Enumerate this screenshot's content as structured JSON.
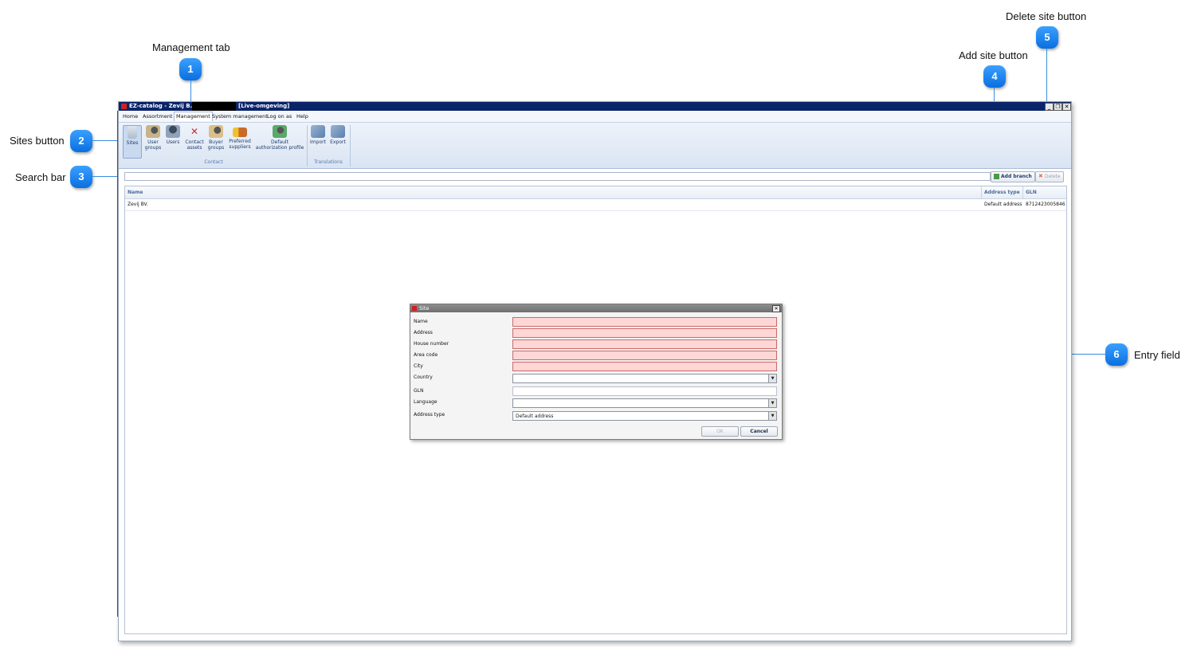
{
  "callouts": {
    "management_tab": {
      "label": "Management tab",
      "number": "1"
    },
    "sites_button": {
      "label": "Sites button",
      "number": "2"
    },
    "search_bar": {
      "label": "Search bar",
      "number": "3"
    },
    "add_site_button": {
      "label": "Add site button",
      "number": "4"
    },
    "delete_site_button": {
      "label": "Delete site button",
      "number": "5"
    },
    "entry_field": {
      "label": "Entry field",
      "number": "6"
    }
  },
  "window": {
    "title": "EZ-catalog - Zevij B.V. -",
    "environment": "[Live-omgeving]",
    "controls": {
      "minimize": "_",
      "restore": "❐",
      "close": "✕"
    }
  },
  "menu": [
    "Home",
    "Assortment",
    "Management",
    "System management",
    "Log on as",
    "Help"
  ],
  "ribbon": {
    "buttons": {
      "sites": "Sites",
      "user_groups_1": "User",
      "user_groups_2": "groups",
      "users": "Users",
      "contact_assets_1": "Contact",
      "contact_assets_2": "assets",
      "buyer_groups_1": "Buyer",
      "buyer_groups_2": "groups",
      "preferred_suppliers_1": "Preferred",
      "preferred_suppliers_2": "suppliers",
      "default_auth_1": "Default",
      "default_auth_2": "authorization profile",
      "import": "Import",
      "export": "Export"
    },
    "groups": {
      "contact": "Contact",
      "translations": "Translations"
    }
  },
  "toolbar": {
    "search_value": "",
    "add_branch_label": "Add branch",
    "delete_label": "Delete"
  },
  "table": {
    "columns": [
      "Name",
      "Address type",
      "GLN"
    ],
    "rows": [
      {
        "name": "Zevij BV.",
        "address_type": "Default address",
        "gln": "8712423005846"
      }
    ]
  },
  "dialog": {
    "title": "Site",
    "close": "✕",
    "fields": {
      "name": "Name",
      "address": "Address",
      "house_number": "House number",
      "area_code": "Area code",
      "city": "City",
      "country": "Country",
      "gln": "GLN",
      "language": "Language",
      "address_type": "Address type"
    },
    "address_type_value": "Default address",
    "ok_label": "OK",
    "cancel_label": "Cancel"
  },
  "colors": {
    "accent": "#0a6fe0",
    "titlebar": "#0a246a",
    "required_field": "#ffd6d6"
  }
}
